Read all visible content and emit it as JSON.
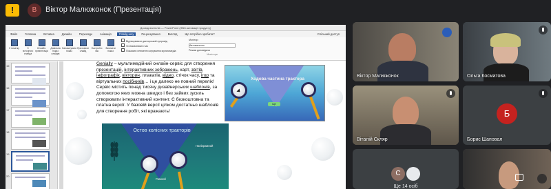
{
  "meet": {
    "presenter_initial": "В",
    "presenter_title": "Віктор Малюжонок (Презентація)",
    "others_label": "Ще 14 осіб",
    "others_initial": "C"
  },
  "ppt": {
    "window_title": "Досвід вчителів — PowerPoint (Збій активації продукту)",
    "tabs": [
      "Файл",
      "Головна",
      "Вставка",
      "Дизайн",
      "Переходи",
      "Анімація",
      "Слайд-шоу",
      "Рецензування",
      "Вигляд",
      "Що потрібно зробити?",
      "Спільний доступ"
    ],
    "active_tab": "Слайд-шоу",
    "ribbon_buttons": [
      "З початку",
      "З поточного слайда",
      "Онлайн-презентація",
      "Довільна показ слайдів",
      "Налаштувати показ",
      "Приховати слайд",
      "Настроїти час",
      "Записати показ"
    ],
    "ribbon_checks": [
      "Відтворювати дикторський супровід",
      "Установлювати час",
      "Показати елементи керування мультимедіа"
    ],
    "ribbon_monitor_label": "Монітор:",
    "ribbon_monitor_value": "Автоматично",
    "ribbon_presenter_check": "Режим доповідача",
    "ribbon_group_label": "Монітори",
    "slide_numbers": [
      "15",
      "16",
      "17",
      "18",
      "19",
      "20"
    ],
    "slide_text_parts": [
      "Genially",
      " – мультимедійний онлайн-сервіс для створення ",
      "презентацій",
      ", ",
      "інтерактивних зображень",
      ", карт, ",
      "звітів",
      ", ",
      "інфографік",
      ", ",
      "вікторин",
      ", плакатів, ",
      "відео",
      ", стічок часу, ",
      "ігор",
      " та віртуальних ",
      "посібників",
      "… і це далеко не повний перелік! Сервіс містить понад тисячу дизайнерських ",
      "шаблонів",
      ", за допомогою яких можна швидко і без зайвих зусиль створювати інтерактивний контент. Є безкоштовна та платна версії. У базовій версії цілком достатньо шаблонів для створення робіт, які вражають!"
    ],
    "img1_title": "Ходова частина трактора",
    "img1_button": "Ще",
    "img2_title": "Остов колісних тракторів",
    "img2_label1": "Напіврамний",
    "img2_label2": "Рамний"
  },
  "participants": [
    {
      "name": "Віктор Малюжонок"
    },
    {
      "name": "Ольга Косматова"
    },
    {
      "name": "Віталій Скляр"
    },
    {
      "name": "Борис Шаповал",
      "initial": "Б"
    }
  ],
  "colors": {
    "meet_bg": "#202124",
    "tile_bg": "#3c4043",
    "avatar_red": "#c5221f",
    "ppt_accent": "#2b579a"
  }
}
